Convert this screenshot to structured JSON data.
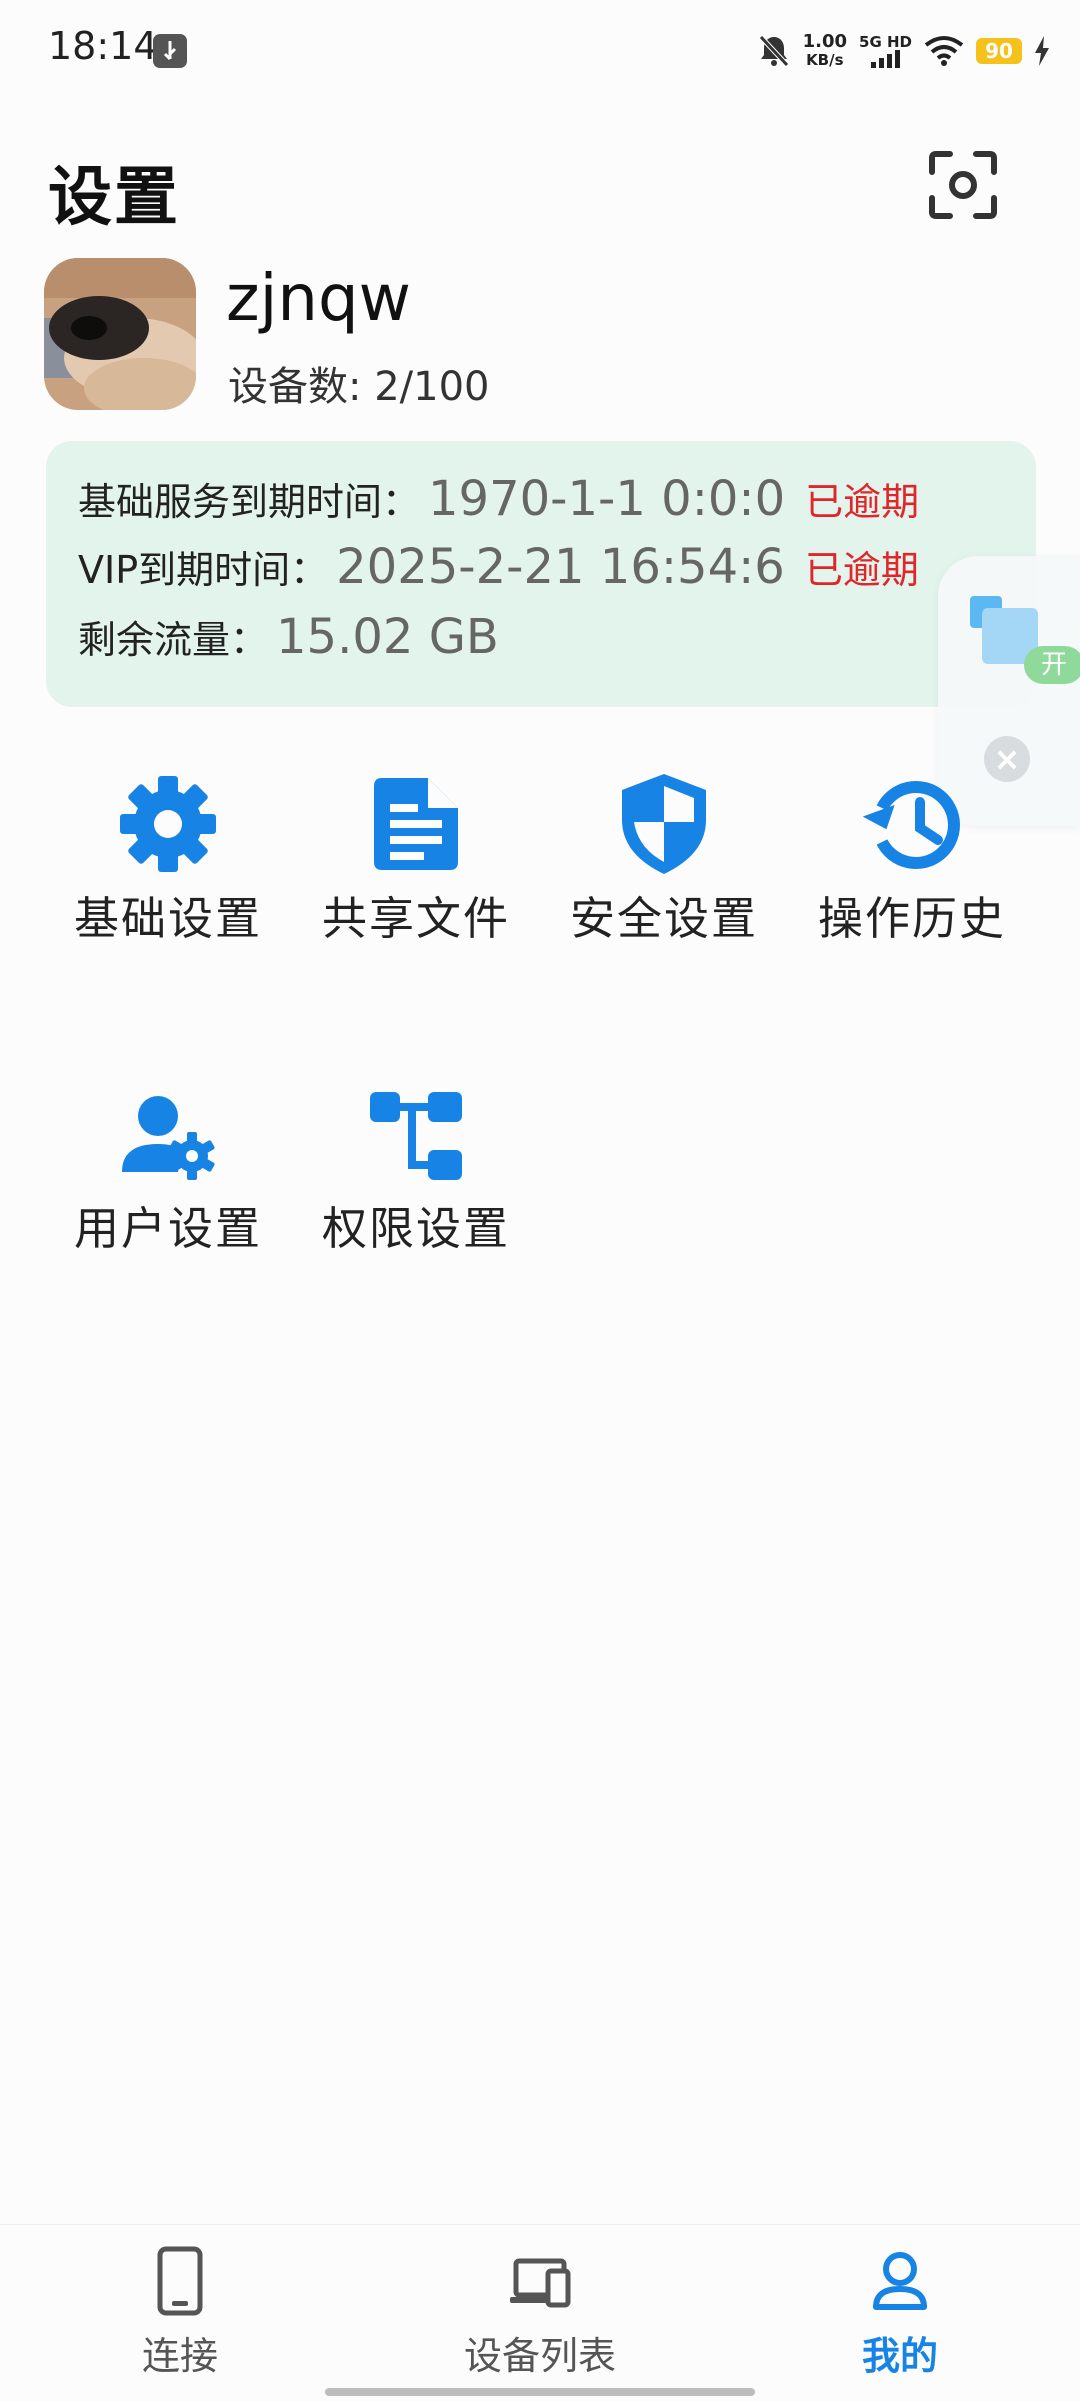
{
  "status_bar": {
    "time": "18:14",
    "speed_value": "1.00",
    "speed_unit": "KB/s",
    "network": "5G HD",
    "battery": "90"
  },
  "header": {
    "title": "设置",
    "scan_icon": "scan-icon"
  },
  "profile": {
    "username": "zjnqw",
    "device_count": "设备数: 2/100"
  },
  "service_info": {
    "basic_label": "基础服务到期时间：",
    "basic_value": "1970-1-1 0:0:0",
    "basic_status": "已逾期",
    "vip_label": "VIP到期时间：",
    "vip_value": "2025-2-21 16:54:6",
    "vip_status": "已逾期",
    "traffic_label": "剩余流量：",
    "traffic_value": "15.02 GB",
    "status_color": "#e0262b",
    "card_color": "#e3f4ec"
  },
  "floating_widget": {
    "open_label": "开",
    "close_icon": "close-icon"
  },
  "menu": {
    "accent": "#1683e5",
    "items": [
      {
        "label": "基础设置",
        "icon": "gear-icon"
      },
      {
        "label": "共享文件",
        "icon": "document-icon"
      },
      {
        "label": "安全设置",
        "icon": "shield-icon"
      },
      {
        "label": "操作历史",
        "icon": "history-icon"
      },
      {
        "label": "用户设置",
        "icon": "user-gear-icon"
      },
      {
        "label": "权限设置",
        "icon": "hierarchy-icon"
      }
    ]
  },
  "bottom_nav": {
    "items": [
      {
        "label": "连接",
        "icon": "phone-icon"
      },
      {
        "label": "设备列表",
        "icon": "devices-icon"
      },
      {
        "label": "我的",
        "icon": "user-icon",
        "active": true
      }
    ]
  }
}
